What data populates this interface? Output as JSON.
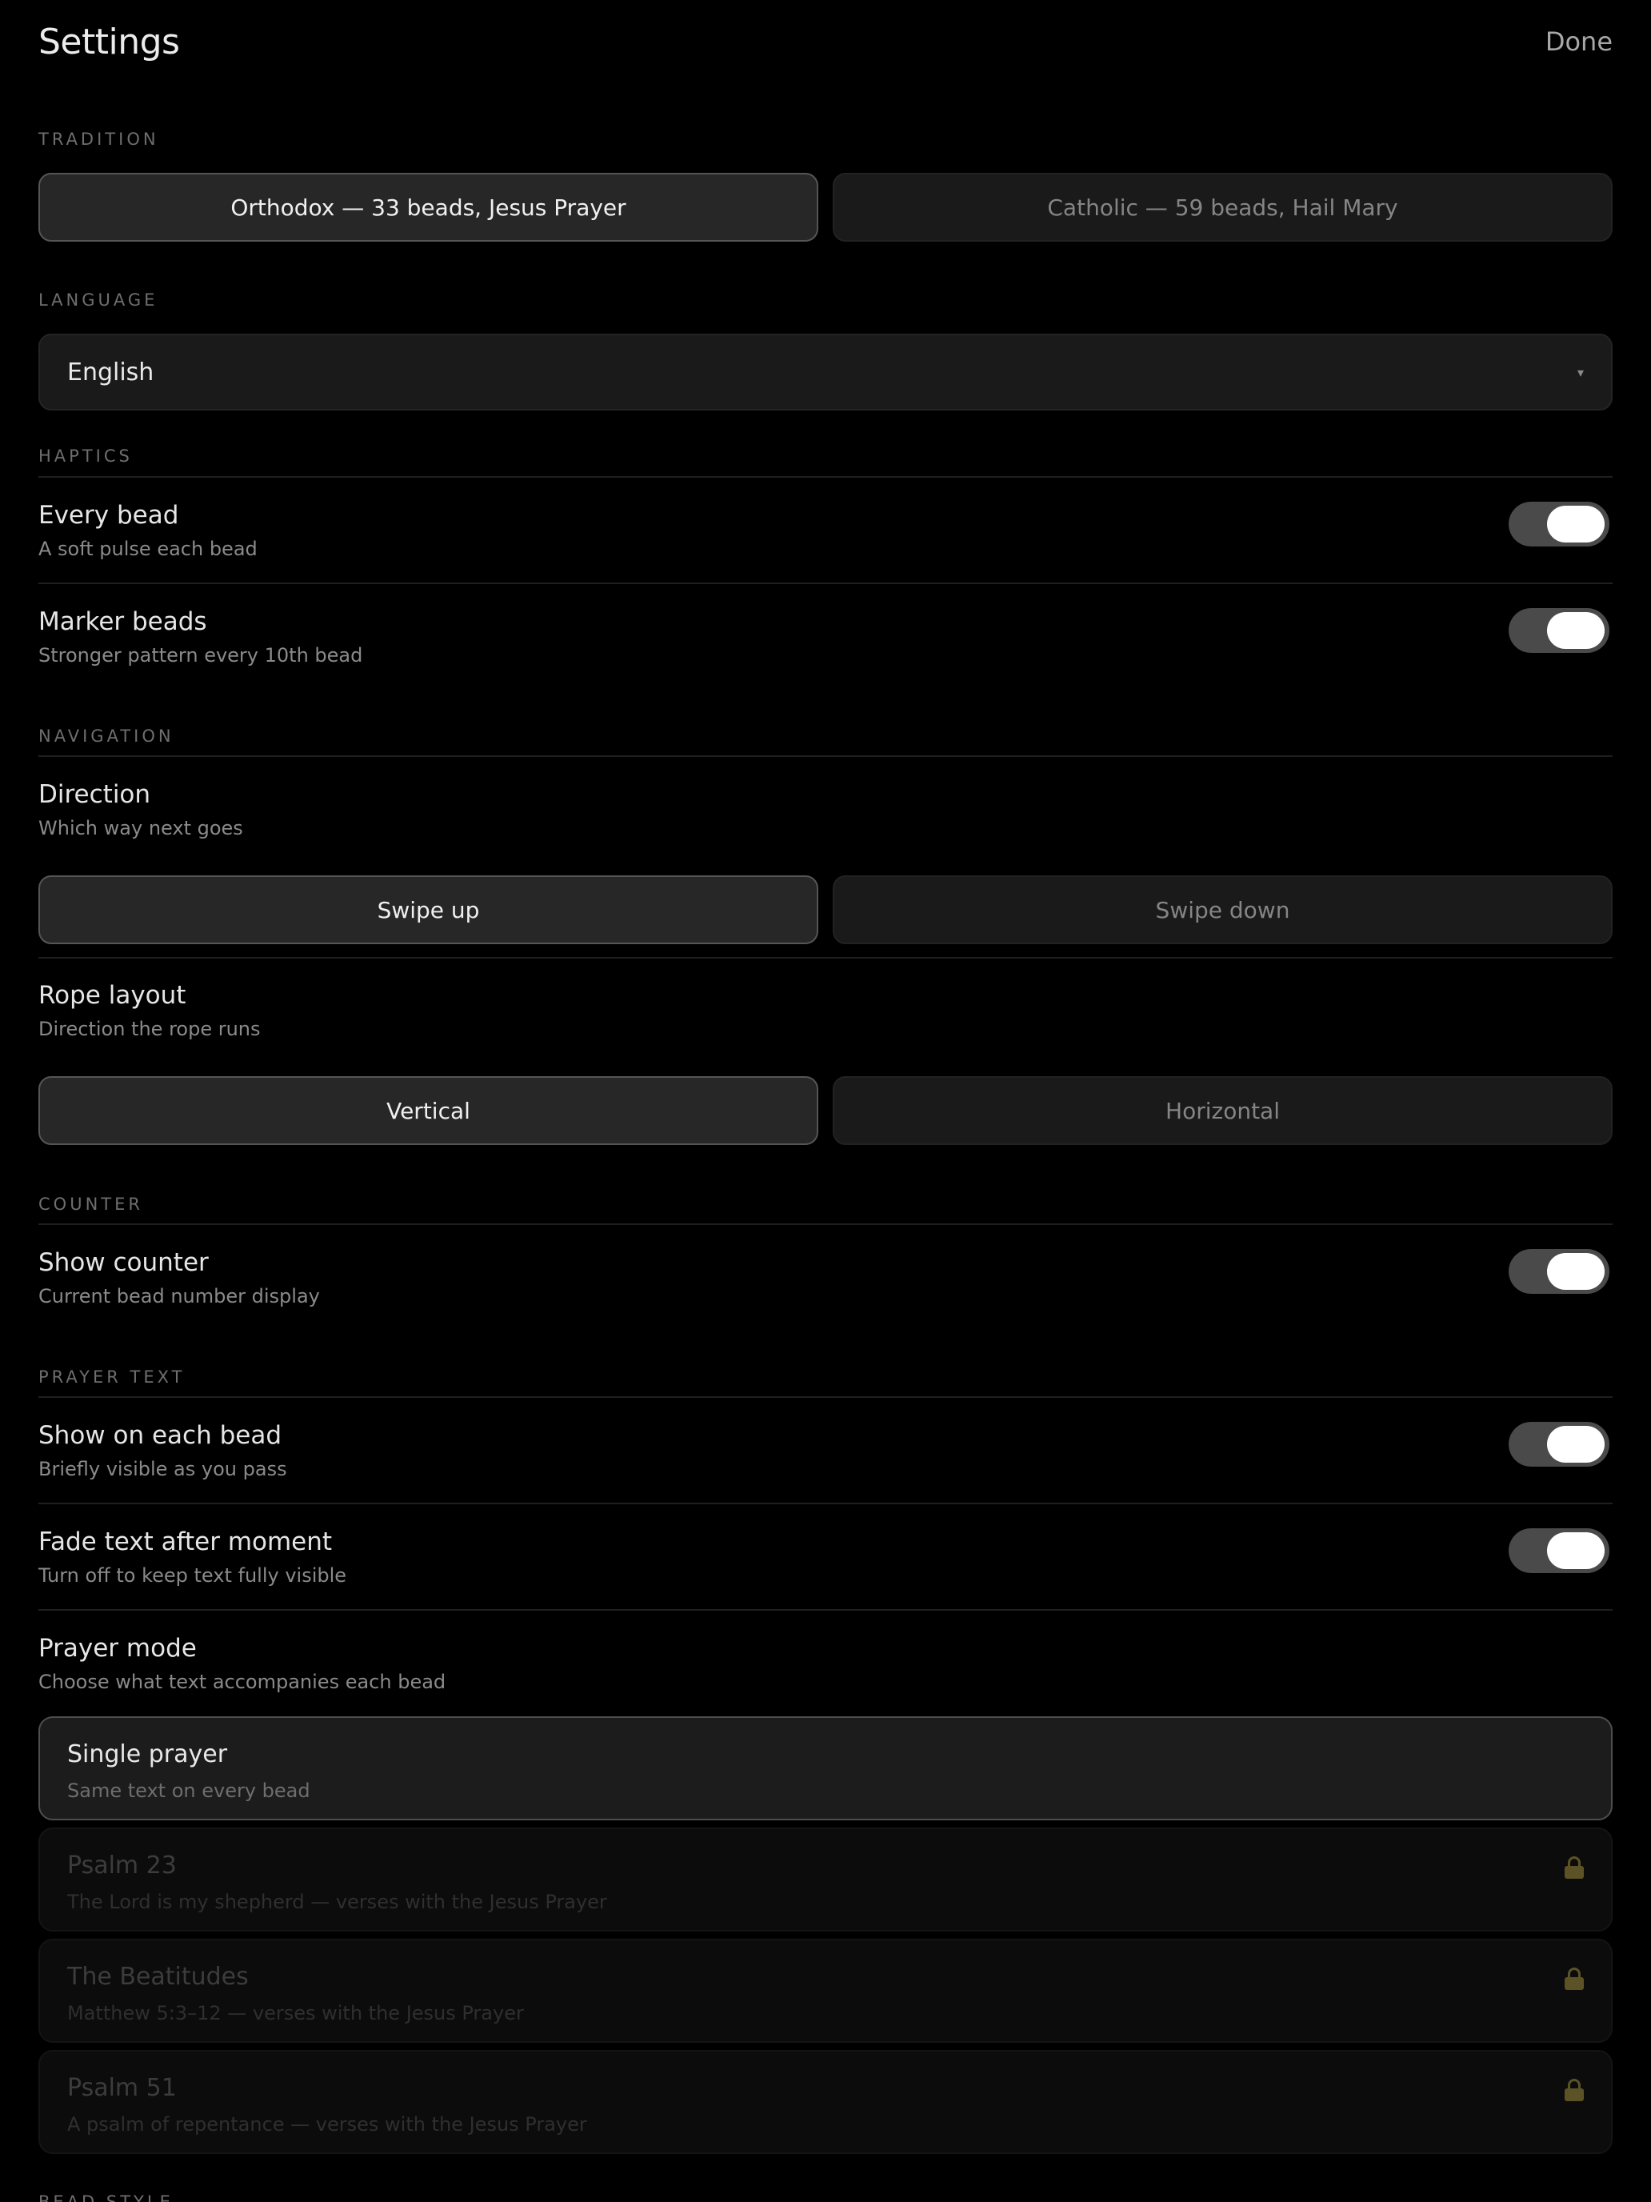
{
  "header": {
    "title": "Settings",
    "done_label": "Done"
  },
  "sections": {
    "tradition": "TRADITION",
    "language": "LANGUAGE",
    "haptics": "HAPTICS",
    "navigation": "NAVIGATION",
    "counter": "COUNTER",
    "prayer_text": "PRAYER TEXT",
    "bead_style": "BEAD STYLE"
  },
  "tradition": {
    "options": [
      "Orthodox — 33 beads, Jesus Prayer",
      "Catholic — 59 beads, Hail Mary"
    ],
    "selected": "Orthodox — 33 beads, Jesus Prayer"
  },
  "language": {
    "value": "English",
    "caret": "▾"
  },
  "haptics": {
    "every_bead": {
      "title": "Every bead",
      "subtitle": "A soft pulse each bead",
      "on": true
    },
    "marker_beads": {
      "title": "Marker beads",
      "subtitle": "Stronger pattern every 10th bead",
      "on": true
    }
  },
  "navigation": {
    "direction": {
      "title": "Direction",
      "subtitle": "Which way next goes",
      "options": [
        "Swipe up",
        "Swipe down"
      ],
      "selected": "Swipe up"
    },
    "rope_layout": {
      "title": "Rope layout",
      "subtitle": "Direction the rope runs",
      "options": [
        "Vertical",
        "Horizontal"
      ],
      "selected": "Vertical"
    }
  },
  "counter": {
    "show_counter": {
      "title": "Show counter",
      "subtitle": "Current bead number display",
      "on": true
    }
  },
  "prayer_text": {
    "show_each": {
      "title": "Show on each bead",
      "subtitle": "Briefly visible as you pass",
      "on": true
    },
    "fade": {
      "title": "Fade text after moment",
      "subtitle": "Turn off to keep text fully visible",
      "on": true
    },
    "mode": {
      "title": "Prayer mode",
      "subtitle": "Choose what text accompanies each bead"
    },
    "modes": [
      {
        "title": "Single prayer",
        "subtitle": "Same text on every bead",
        "state": "selected"
      },
      {
        "title": "Psalm 23",
        "subtitle": "The Lord is my shepherd — verses with the Jesus Prayer",
        "state": "locked",
        "icon": "lock-icon"
      },
      {
        "title": "The Beatitudes",
        "subtitle": "Matthew 5:3–12 — verses with the Jesus Prayer",
        "state": "locked",
        "icon": "lock-icon"
      },
      {
        "title": "Psalm 51",
        "subtitle": "A psalm of repentance — verses with the Jesus Prayer",
        "state": "locked",
        "icon": "lock-icon"
      }
    ]
  },
  "colors": {
    "background": "#000000",
    "toggle_track": "#4a4a4a",
    "toggle_knob": "#ffffff",
    "lock": "#5b5326"
  }
}
